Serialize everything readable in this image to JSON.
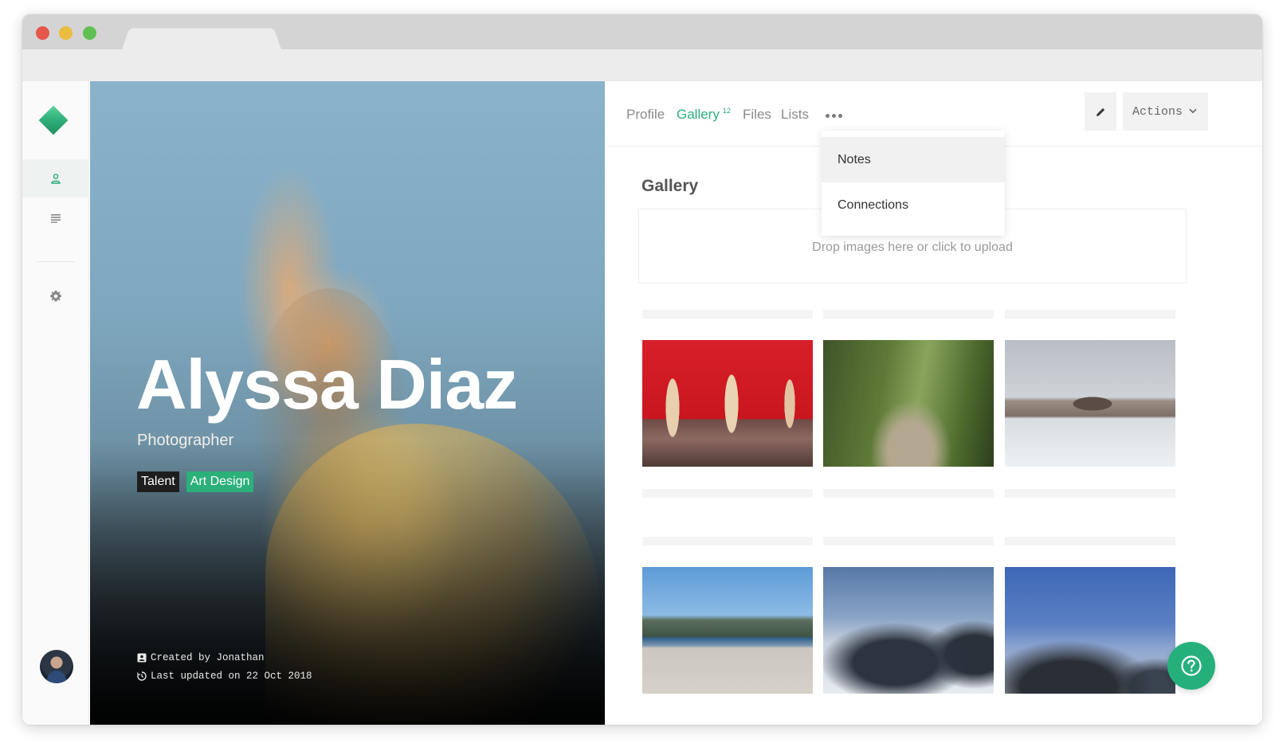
{
  "profile": {
    "name": "Alyssa Diaz",
    "role": "Photographer",
    "tags": [
      "Talent",
      "Art Design"
    ],
    "created_by": "Created by Jonathan",
    "last_updated": "Last updated on 22 Oct 2018"
  },
  "nav": {
    "tabs": [
      {
        "label": "Profile"
      },
      {
        "label": "Gallery",
        "count": "12"
      },
      {
        "label": "Files"
      },
      {
        "label": "Lists"
      }
    ],
    "more_menu": [
      "Notes",
      "Connections"
    ],
    "actions_label": "Actions"
  },
  "gallery": {
    "title": "Gallery",
    "dropzone_text": "Drop images here or click to upload",
    "images": [
      "statues-red-wall",
      "overgrown-path",
      "city-waterfront-snow",
      "trucks-harbor",
      "snowy-mountains-clouds",
      "mountain-blue-sky"
    ]
  },
  "colors": {
    "accent": "#2cae78",
    "help_button": "#25b07b"
  },
  "icons": {
    "sidebar": [
      "user-icon",
      "list-icon",
      "gear-icon"
    ],
    "edit": "pencil-icon",
    "actions": "chevron-down-icon",
    "help": "question-icon"
  }
}
